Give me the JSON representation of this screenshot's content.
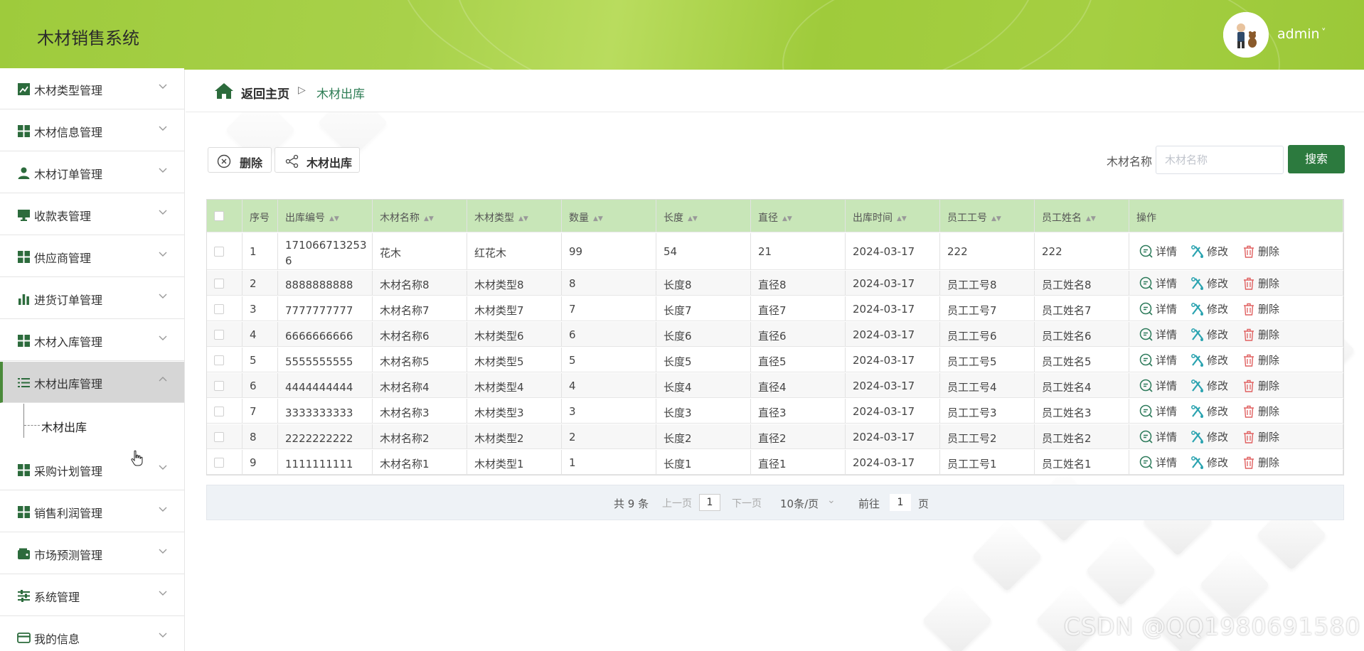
{
  "header": {
    "app_title": "木材销售系统",
    "user_name": "admin",
    "user_caret": "˅",
    "accent_color": "#9fcb3c"
  },
  "sidebar": {
    "items": [
      {
        "label": "木材类型管理",
        "icon": "line-chart-icon"
      },
      {
        "label": "木材信息管理",
        "icon": "grid-icon"
      },
      {
        "label": "木材订单管理",
        "icon": "user-icon"
      },
      {
        "label": "收款表管理",
        "icon": "monitor-icon"
      },
      {
        "label": "供应商管理",
        "icon": "grid-icon"
      },
      {
        "label": "进货订单管理",
        "icon": "bar-chart-icon"
      },
      {
        "label": "木材入库管理",
        "icon": "grid-icon"
      },
      {
        "label": "木材出库管理",
        "icon": "list-icon",
        "expanded": true,
        "active": true
      },
      {
        "label": "采购计划管理",
        "icon": "grid-icon"
      },
      {
        "label": "销售利润管理",
        "icon": "grid-icon"
      },
      {
        "label": "市场预测管理",
        "icon": "wallet-icon"
      },
      {
        "label": "系统管理",
        "icon": "sliders-icon"
      },
      {
        "label": "我的信息",
        "icon": "card-icon"
      }
    ],
    "sub_item": "木材出库"
  },
  "breadcrumb": {
    "home": "返回主页",
    "separator": "▷",
    "current": "木材出库"
  },
  "toolbar": {
    "delete_label": "删除",
    "outbound_label": "木材出库"
  },
  "search": {
    "label": "木材名称",
    "placeholder": "木材名称",
    "value": "",
    "button": "搜索"
  },
  "table": {
    "columns": [
      "序号",
      "出库编号",
      "木材名称",
      "木材类型",
      "数量",
      "长度",
      "直径",
      "出库时间",
      "员工工号",
      "员工姓名",
      "操作"
    ],
    "actions": {
      "detail": "详情",
      "edit": "修改",
      "delete": "删除"
    },
    "rows": [
      {
        "idx": "1",
        "code_line1": "171066713253",
        "code_line2": "6",
        "name": "花木",
        "type": "红花木",
        "qty": "99",
        "length": "54",
        "diameter": "21",
        "time": "2024-03-17",
        "emp_no": "222",
        "emp_name": "222"
      },
      {
        "idx": "2",
        "code_line1": "8888888888",
        "code_line2": "",
        "name": "木材名称8",
        "type": "木材类型8",
        "qty": "8",
        "length": "长度8",
        "diameter": "直径8",
        "time": "2024-03-17",
        "emp_no": "员工工号8",
        "emp_name": "员工姓名8"
      },
      {
        "idx": "3",
        "code_line1": "7777777777",
        "code_line2": "",
        "name": "木材名称7",
        "type": "木材类型7",
        "qty": "7",
        "length": "长度7",
        "diameter": "直径7",
        "time": "2024-03-17",
        "emp_no": "员工工号7",
        "emp_name": "员工姓名7"
      },
      {
        "idx": "4",
        "code_line1": "6666666666",
        "code_line2": "",
        "name": "木材名称6",
        "type": "木材类型6",
        "qty": "6",
        "length": "长度6",
        "diameter": "直径6",
        "time": "2024-03-17",
        "emp_no": "员工工号6",
        "emp_name": "员工姓名6"
      },
      {
        "idx": "5",
        "code_line1": "5555555555",
        "code_line2": "",
        "name": "木材名称5",
        "type": "木材类型5",
        "qty": "5",
        "length": "长度5",
        "diameter": "直径5",
        "time": "2024-03-17",
        "emp_no": "员工工号5",
        "emp_name": "员工姓名5"
      },
      {
        "idx": "6",
        "code_line1": "4444444444",
        "code_line2": "",
        "name": "木材名称4",
        "type": "木材类型4",
        "qty": "4",
        "length": "长度4",
        "diameter": "直径4",
        "time": "2024-03-17",
        "emp_no": "员工工号4",
        "emp_name": "员工姓名4"
      },
      {
        "idx": "7",
        "code_line1": "3333333333",
        "code_line2": "",
        "name": "木材名称3",
        "type": "木材类型3",
        "qty": "3",
        "length": "长度3",
        "diameter": "直径3",
        "time": "2024-03-17",
        "emp_no": "员工工号3",
        "emp_name": "员工姓名3"
      },
      {
        "idx": "8",
        "code_line1": "2222222222",
        "code_line2": "",
        "name": "木材名称2",
        "type": "木材类型2",
        "qty": "2",
        "length": "长度2",
        "diameter": "直径2",
        "time": "2024-03-17",
        "emp_no": "员工工号2",
        "emp_name": "员工姓名2"
      },
      {
        "idx": "9",
        "code_line1": "1111111111",
        "code_line2": "",
        "name": "木材名称1",
        "type": "木材类型1",
        "qty": "1",
        "length": "长度1",
        "diameter": "直径1",
        "time": "2024-03-17",
        "emp_no": "员工工号1",
        "emp_name": "员工姓名1"
      }
    ]
  },
  "pagination": {
    "total": "共 9 条",
    "prev": "上一页",
    "current_page": "1",
    "next": "下一页",
    "page_size": "10条/页",
    "page_size_caret": "⌄",
    "goto_prefix": "前往",
    "goto_value": "1",
    "goto_suffix": "页"
  },
  "watermark": "CSDN @QQ1980691580"
}
